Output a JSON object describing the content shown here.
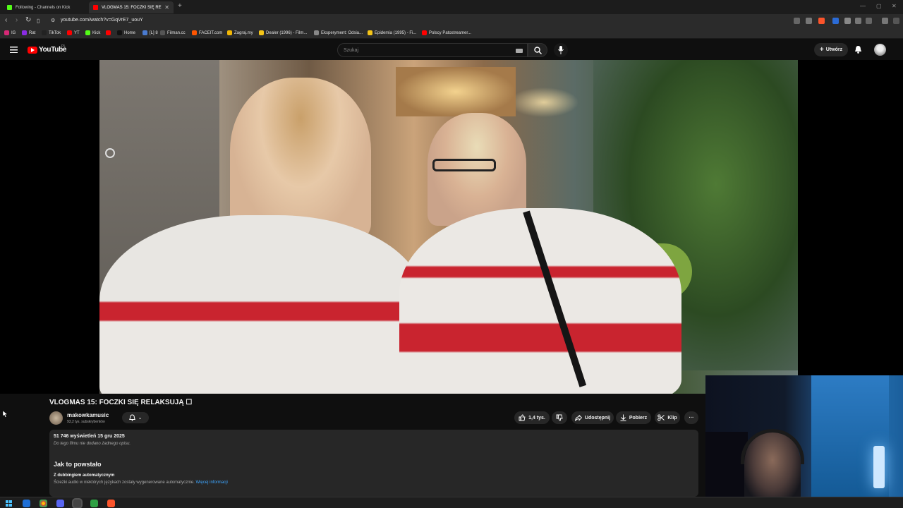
{
  "browser": {
    "tabs": [
      {
        "label": "Following - Channels on Kick",
        "active": false,
        "favicon_color": "#53fc18"
      },
      {
        "label": "VLOGMAS 15: FOCZKI SIĘ RE",
        "active": true,
        "favicon_color": "#ff0000"
      }
    ],
    "url": "youtube.com/watch?v=GqVrE7_uouY",
    "bookmarks": [
      {
        "label": "IG",
        "color": "#d62976"
      },
      {
        "label": "Rat",
        "color": "#8a2be2"
      },
      {
        "label": "TikTok",
        "color": "#222222"
      },
      {
        "label": "YT",
        "color": "#ff0000"
      },
      {
        "label": "Kick",
        "color": "#53fc18"
      },
      {
        "label": "",
        "color": "#ff0000"
      },
      {
        "label": "Home",
        "color": "#111111"
      },
      {
        "label": "[L] 8",
        "color": "#4a7bd0"
      },
      {
        "label": "Filman.cc",
        "color": "#555555"
      },
      {
        "label": "FACEIT.com",
        "color": "#ff5500"
      },
      {
        "label": "Zagraj.my",
        "color": "#f2b705"
      },
      {
        "label": "Dealer (1996) - Film...",
        "color": "#f5c518"
      },
      {
        "label": "Eksperyment: Odsia...",
        "color": "#888888"
      },
      {
        "label": "Epidemia (1995) - Fi...",
        "color": "#f5c518"
      },
      {
        "label": "Polscy Patostreamer...",
        "color": "#ff0000"
      }
    ]
  },
  "youtube": {
    "logo_text": "YouTube",
    "logo_region": "PL",
    "search_placeholder": "Szukaj",
    "create_label": "Utwórz",
    "brand_color": "#ff0000"
  },
  "video": {
    "title": "VLOGMAS 15: FOCZKI SIĘ RELAKSUJĄ ☐",
    "channel_name": "makowkamusic",
    "subscribers": "93,2 tys. subskrybentów",
    "like_count": "1,4 tys.",
    "share_label": "Udostępnij",
    "download_label": "Pobierz",
    "clip_label": "Klip",
    "more_label": "···",
    "views_and_date": "51 746 wyświetleń  15 gru 2025",
    "no_description": "Do tego filmu nie dodano żadnego opisu.",
    "how_made_heading": "Jak to powstało",
    "dubbing_heading": "Z dubbingiem automatycznym",
    "dubbing_note": "Ścieżki audio w niektórych językach zostały wygenerowane automatycznie.",
    "more_info_link": "Więcej informacji"
  },
  "icons": {
    "back": "arrow-left",
    "forward": "arrow-right",
    "reload": "reload",
    "menu": "hamburger",
    "search": "magnifier",
    "mic": "microphone",
    "notifications": "bell",
    "like": "thumb-up",
    "dislike": "thumb-down",
    "share": "share-arrow",
    "download": "download-arrow",
    "clip": "scissors"
  }
}
